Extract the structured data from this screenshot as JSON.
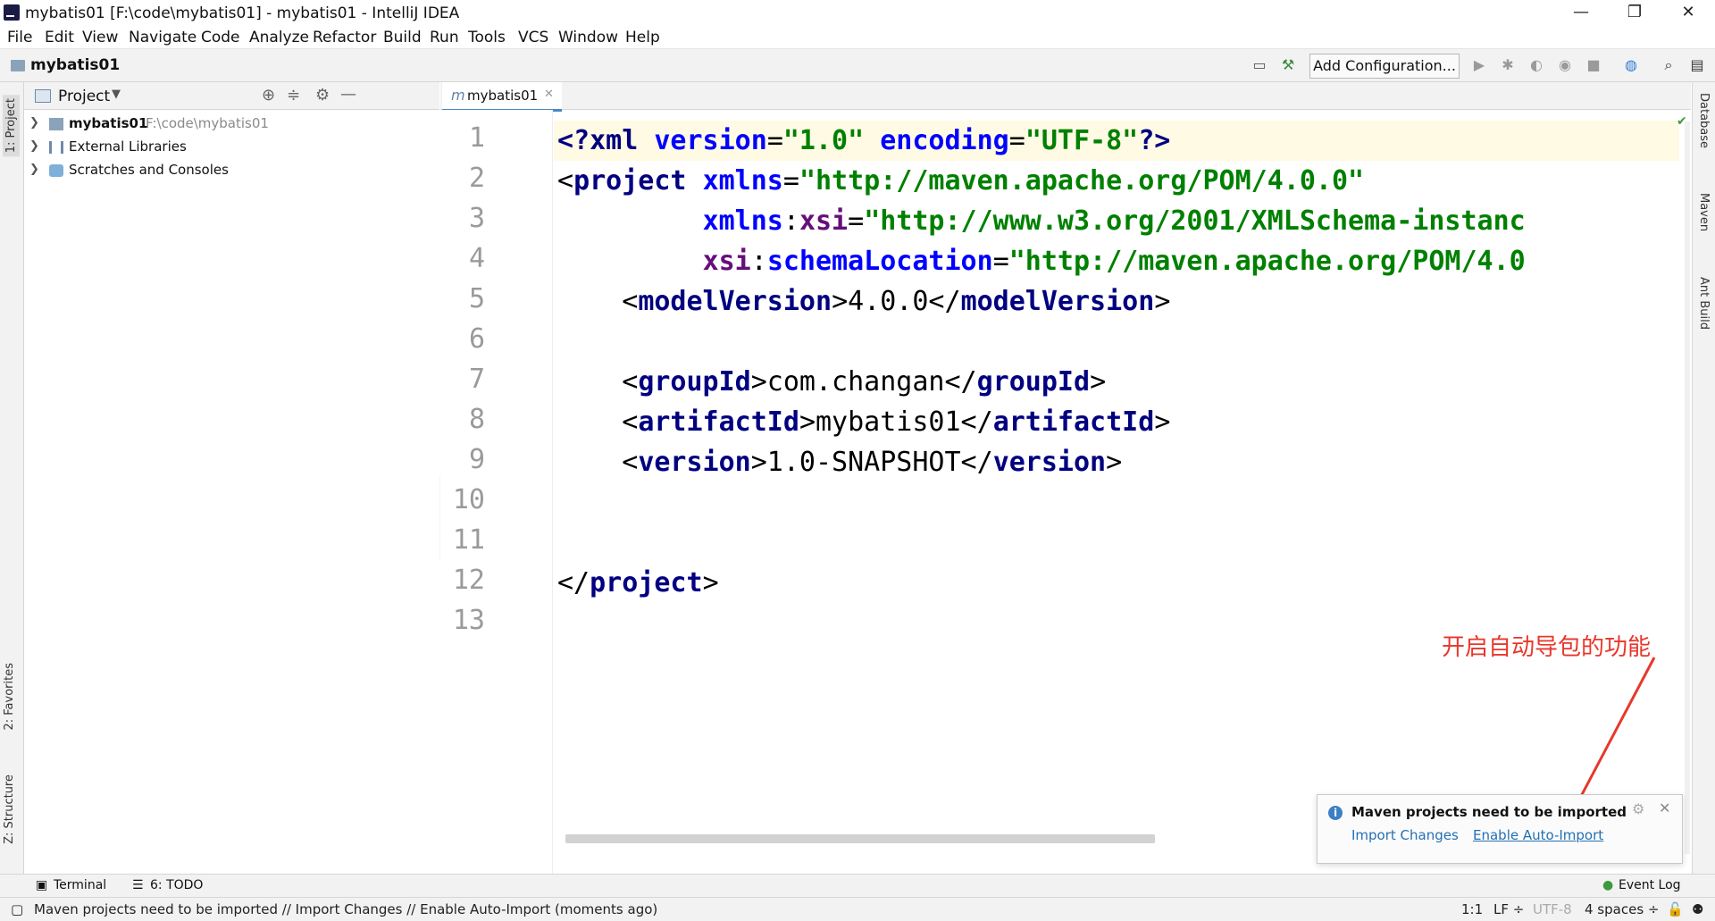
{
  "window": {
    "title": "mybatis01 [F:\\code\\mybatis01] - mybatis01 - IntelliJ IDEA",
    "controls": [
      "—",
      "❐",
      "✕"
    ]
  },
  "menu": [
    "File",
    "Edit",
    "View",
    "Navigate",
    "Code",
    "Analyze",
    "Refactor",
    "Build",
    "Run",
    "Tools",
    "VCS",
    "Window",
    "Help"
  ],
  "navbar": {
    "project_name": "mybatis01",
    "add_configuration": "Add Configuration..."
  },
  "left_stripe": {
    "project_tab": "1: Project",
    "favorites_tab": "2: Favorites",
    "structure_tab": "Z: Structure"
  },
  "right_stripe": {
    "database_tab": "Database",
    "maven_tab": "Maven",
    "ant_tab": "Ant Build"
  },
  "project_panel": {
    "title": "Project",
    "tree": [
      {
        "label": "mybatis01",
        "path": "F:\\code\\mybatis01"
      },
      {
        "label": "External Libraries"
      },
      {
        "label": "Scratches and Consoles"
      }
    ]
  },
  "editor": {
    "tab_label": "mybatis01",
    "line_numbers": [
      "1",
      "2",
      "3",
      "4",
      "5",
      "6",
      "7",
      "8",
      "9",
      "10",
      "11",
      "12",
      "13"
    ],
    "lines": [
      [
        {
          "c": "tag",
          "t": "<?"
        },
        {
          "c": "tag",
          "t": "xml "
        },
        {
          "c": "attr",
          "t": "version"
        },
        {
          "c": "txt",
          "t": "="
        },
        {
          "c": "val",
          "t": "\"1.0\" "
        },
        {
          "c": "attr",
          "t": "encoding"
        },
        {
          "c": "txt",
          "t": "="
        },
        {
          "c": "val",
          "t": "\"UTF-8\""
        },
        {
          "c": "tag",
          "t": "?>"
        }
      ],
      [
        {
          "c": "txt",
          "t": "<"
        },
        {
          "c": "tag",
          "t": "project "
        },
        {
          "c": "attr",
          "t": "xmlns"
        },
        {
          "c": "txt",
          "t": "="
        },
        {
          "c": "val",
          "t": "\"http://maven.apache.org/POM/4.0.0\""
        }
      ],
      [
        {
          "c": "txt",
          "t": "         "
        },
        {
          "c": "attr",
          "t": "xmlns"
        },
        {
          "c": "txt",
          "t": ":"
        },
        {
          "c": "ns",
          "t": "xsi"
        },
        {
          "c": "txt",
          "t": "="
        },
        {
          "c": "val",
          "t": "\"http://www.w3.org/2001/XMLSchema-instanc"
        }
      ],
      [
        {
          "c": "txt",
          "t": "         "
        },
        {
          "c": "ns",
          "t": "xsi"
        },
        {
          "c": "txt",
          "t": ":"
        },
        {
          "c": "attr",
          "t": "schemaLocation"
        },
        {
          "c": "txt",
          "t": "="
        },
        {
          "c": "val",
          "t": "\"http://maven.apache.org/POM/4.0"
        }
      ],
      [
        {
          "c": "txt",
          "t": "    <"
        },
        {
          "c": "tag",
          "t": "modelVersion"
        },
        {
          "c": "txt",
          "t": ">4.0.0</"
        },
        {
          "c": "tag",
          "t": "modelVersion"
        },
        {
          "c": "txt",
          "t": ">"
        }
      ],
      [],
      [
        {
          "c": "txt",
          "t": "    <"
        },
        {
          "c": "tag",
          "t": "groupId"
        },
        {
          "c": "txt",
          "t": ">com.changan</"
        },
        {
          "c": "tag",
          "t": "groupId"
        },
        {
          "c": "txt",
          "t": ">"
        }
      ],
      [
        {
          "c": "txt",
          "t": "    <"
        },
        {
          "c": "tag",
          "t": "artifactId"
        },
        {
          "c": "txt",
          "t": ">mybatis01</"
        },
        {
          "c": "tag",
          "t": "artifactId"
        },
        {
          "c": "txt",
          "t": ">"
        }
      ],
      [
        {
          "c": "txt",
          "t": "    <"
        },
        {
          "c": "tag",
          "t": "version"
        },
        {
          "c": "txt",
          "t": ">1.0-SNAPSHOT</"
        },
        {
          "c": "tag",
          "t": "version"
        },
        {
          "c": "txt",
          "t": ">"
        }
      ],
      [],
      [],
      [
        {
          "c": "txt",
          "t": "</"
        },
        {
          "c": "tag",
          "t": "project"
        },
        {
          "c": "txt",
          "t": ">"
        }
      ],
      []
    ]
  },
  "notification": {
    "message": "Maven projects need to be imported",
    "import_changes": "Import Changes",
    "enable_auto_import": "Enable Auto-Import"
  },
  "annotation": "开启自动导包的功能",
  "bottom_tools": {
    "terminal": "Terminal",
    "todo": "6: TODO",
    "event_log": "Event Log"
  },
  "status": {
    "message": "Maven projects need to be imported // Import Changes // Enable Auto-Import (moments ago)",
    "position": "1:1",
    "line_sep": "LF ÷",
    "encoding": "UTF-8",
    "indent": "4 spaces ÷"
  },
  "colors": {
    "tag": "#000080",
    "attribute": "#0000ff",
    "namespace": "#660e7a",
    "string": "#008000",
    "link": "#2470b3",
    "annotation": "#e8372b"
  }
}
